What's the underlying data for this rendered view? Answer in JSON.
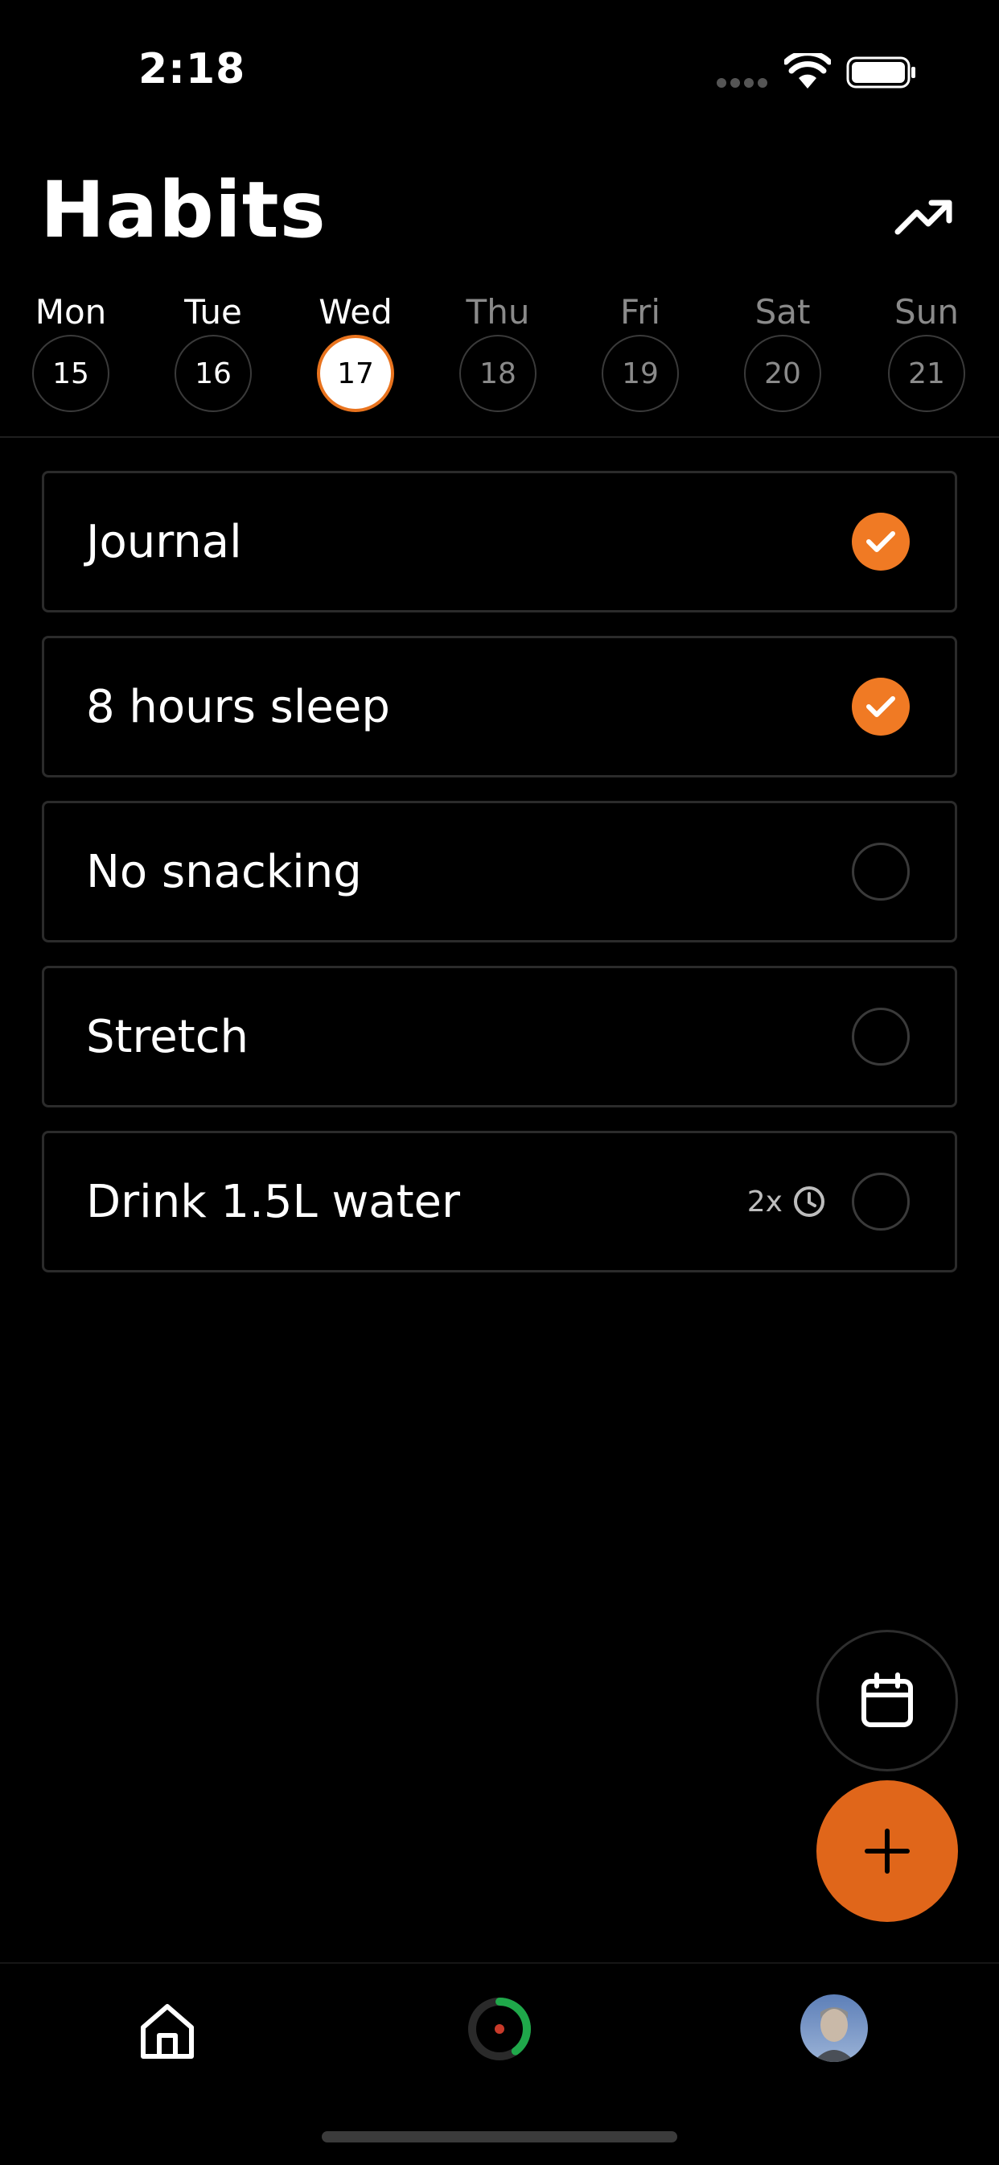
{
  "status": {
    "time": "2:18"
  },
  "header": {
    "title": "Habits"
  },
  "week": {
    "days": [
      {
        "name": "Mon",
        "date": "15"
      },
      {
        "name": "Tue",
        "date": "16"
      },
      {
        "name": "Wed",
        "date": "17"
      },
      {
        "name": "Thu",
        "date": "18"
      },
      {
        "name": "Fri",
        "date": "19"
      },
      {
        "name": "Sat",
        "date": "20"
      },
      {
        "name": "Sun",
        "date": "21"
      }
    ],
    "selected": "Wed"
  },
  "habits": [
    {
      "label": "Journal",
      "done": true
    },
    {
      "label": "8 hours sleep",
      "done": true
    },
    {
      "label": "No snacking",
      "done": false
    },
    {
      "label": "Stretch",
      "done": false
    },
    {
      "label": "Drink 1.5L water",
      "done": false,
      "reminder": "2x"
    }
  ],
  "colors": {
    "accent": "#f07a24",
    "fab": "#e0661a",
    "progress": "#1fa84a"
  },
  "tabs": {
    "progress_ring_fraction": 0.4
  }
}
